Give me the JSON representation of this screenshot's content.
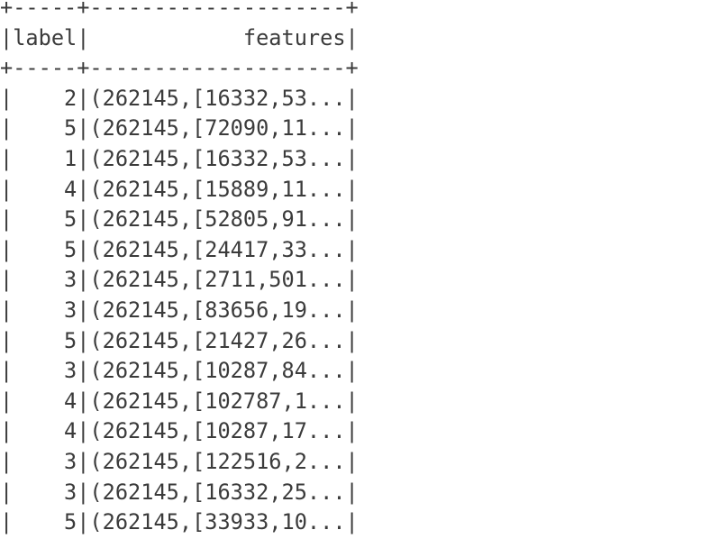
{
  "output": {
    "border_top": "+-----+--------------------+",
    "header": "|label|            features|",
    "border_mid": "+-----+--------------------+",
    "rows": [
      "|    2|(262145,[16332,53...|",
      "|    5|(262145,[72090,11...|",
      "|    1|(262145,[16332,53...|",
      "|    4|(262145,[15889,11...|",
      "|    5|(262145,[52805,91...|",
      "|    5|(262145,[24417,33...|",
      "|    3|(262145,[2711,501...|",
      "|    3|(262145,[83656,19...|",
      "|    5|(262145,[21427,26...|",
      "|    3|(262145,[10287,84...|",
      "|    4|(262145,[102787,1...|",
      "|    4|(262145,[10287,17...|",
      "|    3|(262145,[122516,2...|",
      "|    3|(262145,[16332,25...|",
      "|    5|(262145,[33933,10...|"
    ]
  }
}
